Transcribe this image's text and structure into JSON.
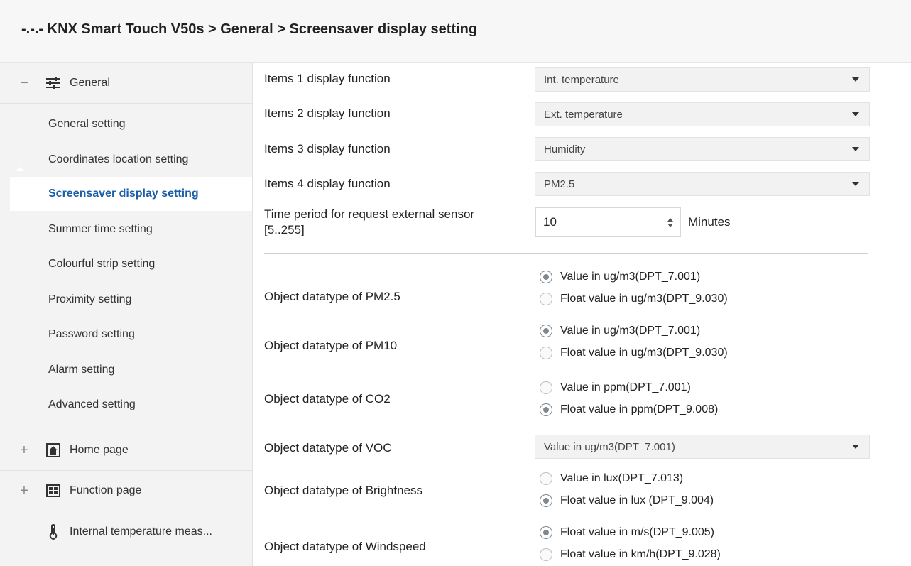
{
  "breadcrumb": "-.-.- KNX Smart Touch V50s > General > Screensaver display setting",
  "sidebar": {
    "general_section": {
      "toggle": "−",
      "label": "General",
      "icon": "sliders-icon"
    },
    "items": [
      {
        "label": "General setting"
      },
      {
        "label": "Coordinates location setting"
      },
      {
        "label": "Screensaver display setting",
        "active": true
      },
      {
        "label": "Summer time setting"
      },
      {
        "label": "Colourful strip setting"
      },
      {
        "label": "Proximity setting"
      },
      {
        "label": "Password setting"
      },
      {
        "label": "Alarm setting"
      },
      {
        "label": "Advanced setting"
      }
    ],
    "home_section": {
      "toggle": "+",
      "label": "Home page",
      "icon": "home-icon"
    },
    "function_section": {
      "toggle": "+",
      "label": "Function page",
      "icon": "grid-icon"
    },
    "temp_section": {
      "label": "Internal temperature meas...",
      "icon": "thermometer-icon"
    }
  },
  "settings": {
    "items1": {
      "label": "Items 1 display function",
      "value": "Int. temperature"
    },
    "items2": {
      "label": "Items 2 display function",
      "value": "Ext. temperature"
    },
    "items3": {
      "label": "Items 3 display function",
      "value": "Humidity"
    },
    "items4": {
      "label": "Items 4 display function",
      "value": "PM2.5"
    },
    "period": {
      "label_line1": "Time period for request external sensor",
      "label_line2": "[5..255]",
      "value": "10",
      "unit": "Minutes"
    },
    "pm25": {
      "label": "Object datatype of PM2.5",
      "opt1": "Value in ug/m3(DPT_7.001)",
      "opt2": "Float value in ug/m3(DPT_9.030)",
      "selected": 1
    },
    "pm10": {
      "label": "Object datatype of PM10",
      "opt1": "Value in ug/m3(DPT_7.001)",
      "opt2": "Float value in ug/m3(DPT_9.030)",
      "selected": 1
    },
    "co2": {
      "label": "Object datatype of CO2",
      "opt1": "Value in ppm(DPT_7.001)",
      "opt2": "Float value in ppm(DPT_9.008)",
      "selected": 2
    },
    "voc": {
      "label": "Object datatype of VOC",
      "value": "Value in ug/m3(DPT_7.001)"
    },
    "brightness": {
      "label": "Object datatype of Brightness",
      "opt1": "Value in lux(DPT_7.013)",
      "opt2": "Float value in lux (DPT_9.004)",
      "selected": 2
    },
    "windspeed": {
      "label": "Object datatype of Windspeed",
      "opt1": "Float value in m/s(DPT_9.005)",
      "opt2": "Float value in km/h(DPT_9.028)",
      "selected": 1
    }
  }
}
